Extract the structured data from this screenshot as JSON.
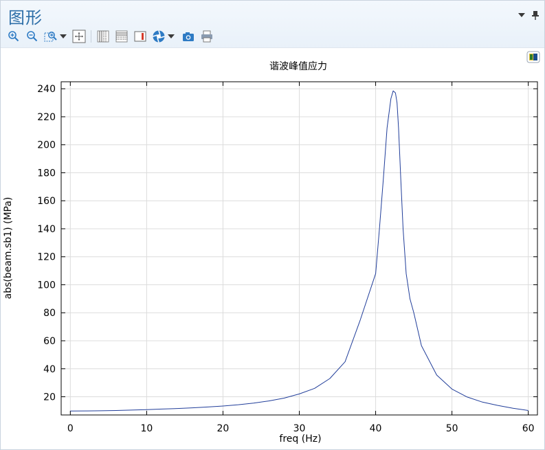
{
  "window": {
    "title": "图形"
  },
  "toolbar": {
    "buttons": [
      {
        "name": "zoom-in-button",
        "icon": "zoom-in-icon"
      },
      {
        "name": "zoom-out-button",
        "icon": "zoom-out-icon"
      },
      {
        "name": "zoom-box-button",
        "icon": "zoom-box-icon"
      },
      {
        "name": "zoom-extents-button",
        "icon": "zoom-extents-icon"
      },
      {
        "name": "x-axis-log-button",
        "icon": "vertical-grid-icon"
      },
      {
        "name": "y-axis-log-button",
        "icon": "horizontal-grid-icon"
      },
      {
        "name": "legend-button",
        "icon": "legend-icon"
      },
      {
        "name": "scene-light-button",
        "icon": "aperture-icon"
      },
      {
        "name": "image-snapshot-button",
        "icon": "camera-icon"
      },
      {
        "name": "print-button",
        "icon": "printer-icon"
      }
    ]
  },
  "colors": {
    "accent": "#2e6fa8",
    "line": "#1f3c99",
    "grid": "#dcdcdc"
  },
  "chart_data": {
    "type": "line",
    "title": "谐波峰值应力",
    "xlabel": "freq (Hz)",
    "ylabel": "abs(beam.sb1) (MPa)",
    "xlim": [
      -1.2,
      61.2
    ],
    "ylim": [
      7,
      245
    ],
    "xticks": [
      0,
      10,
      20,
      30,
      40,
      50,
      60
    ],
    "yticks": [
      20,
      40,
      60,
      80,
      100,
      120,
      140,
      160,
      180,
      200,
      220,
      240
    ],
    "grid": true,
    "series": [
      {
        "x": [
          0,
          2,
          4,
          6,
          8,
          10,
          12,
          14,
          16,
          18,
          20,
          22,
          24,
          26,
          28,
          30,
          32,
          34,
          36,
          38,
          40,
          40.5,
          41,
          41.5,
          42,
          42.3,
          42.6,
          42.8,
          43,
          43.3,
          43.6,
          44,
          44.5,
          45,
          46,
          48,
          50,
          52,
          54,
          56,
          58,
          60
        ],
        "y": [
          9.8,
          9.9,
          10,
          10.2,
          10.5,
          10.8,
          11.2,
          11.6,
          12.1,
          12.7,
          13.4,
          14.3,
          15.5,
          17,
          19,
          22,
          26,
          33,
          45,
          75,
          108,
          140,
          175,
          212,
          233,
          238.5,
          237,
          230,
          212,
          175,
          140,
          108,
          90,
          80,
          56.5,
          35.5,
          25.5,
          19.8,
          16.2,
          13.8,
          11.8,
          10.2
        ]
      }
    ]
  }
}
